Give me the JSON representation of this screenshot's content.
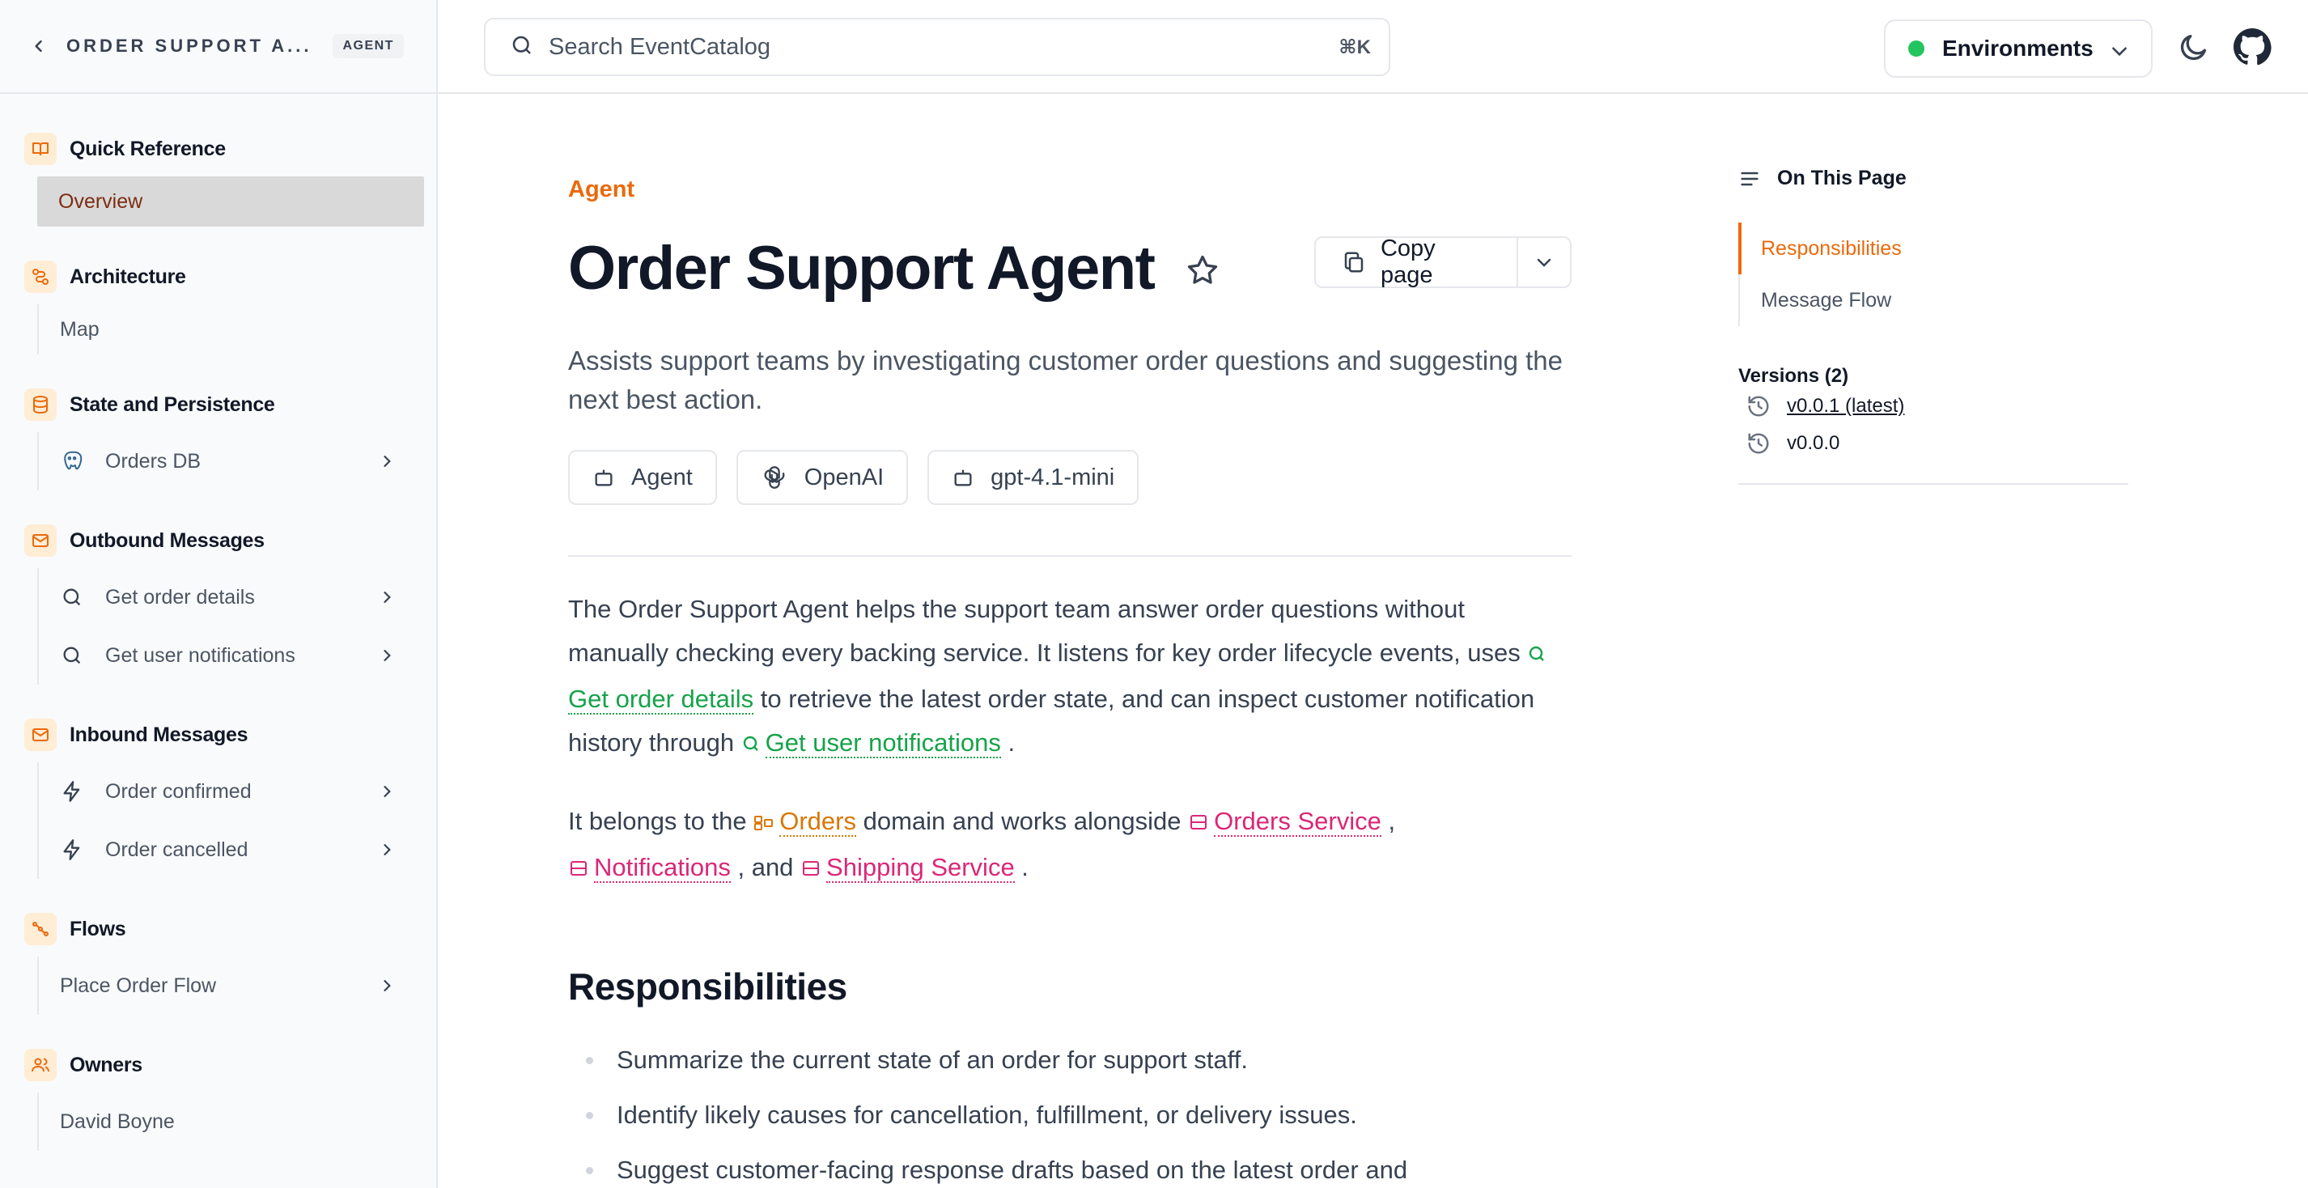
{
  "sidebar": {
    "title": "ORDER SUPPORT A...",
    "badge": "AGENT",
    "groups": [
      {
        "label": "Quick Reference",
        "icon": "book-icon",
        "items": [
          {
            "label": "Overview"
          }
        ]
      },
      {
        "label": "Architecture",
        "icon": "map-icon",
        "items": [
          {
            "label": "Map"
          }
        ]
      },
      {
        "label": "State and Persistence",
        "icon": "database-icon",
        "items": [
          {
            "label": "Orders DB"
          }
        ]
      },
      {
        "label": "Outbound Messages",
        "icon": "mail-icon",
        "items": [
          {
            "label": "Get order details"
          },
          {
            "label": "Get user notifications"
          }
        ]
      },
      {
        "label": "Inbound Messages",
        "icon": "mail-icon",
        "items": [
          {
            "label": "Order confirmed"
          },
          {
            "label": "Order cancelled"
          }
        ]
      },
      {
        "label": "Flows",
        "icon": "flow-icon",
        "items": [
          {
            "label": "Place Order Flow"
          }
        ]
      },
      {
        "label": "Owners",
        "icon": "users-icon",
        "items": [
          {
            "label": "David Boyne"
          }
        ]
      }
    ]
  },
  "topbar": {
    "search_placeholder": "Search EventCatalog",
    "shortcut": "⌘K",
    "environments": "Environments"
  },
  "main": {
    "kicker": "Agent",
    "title": "Order Support Agent",
    "copy_label": "Copy page",
    "summary": "Assists support teams by investigating customer order questions and suggesting the next best action.",
    "chips": [
      {
        "label": "Agent"
      },
      {
        "label": "OpenAI"
      },
      {
        "label": "gpt-4.1-mini"
      }
    ],
    "p1": {
      "t1": "The Order Support Agent helps the support team answer order questions without manually checking every backing service. It listens for key order lifecycle events, uses ",
      "link1": "Get order details",
      "t2": " to retrieve the latest order state, and can inspect customer notification history through ",
      "link2": "Get user notifications",
      "t3": " ."
    },
    "p2": {
      "t1": "It belongs to the ",
      "domain": "Orders",
      "t2": " domain and works alongside ",
      "svc1": "Orders Service",
      "t3": " ,",
      "svc2": "Notifications",
      "t4": " , and ",
      "svc3": "Shipping Service",
      "t5": " ."
    },
    "responsibilities_heading": "Responsibilities",
    "responsibilities": [
      "Summarize the current state of an order for support staff.",
      "Identify likely causes for cancellation, fulfillment, or delivery issues.",
      "Suggest customer-facing response drafts based on the latest order and"
    ]
  },
  "toc": {
    "heading": "On This Page",
    "items": [
      {
        "label": "Responsibilities"
      },
      {
        "label": "Message Flow"
      }
    ],
    "versions_heading": "Versions (2)",
    "versions": [
      {
        "label": "v0.0.1 (latest)"
      },
      {
        "label": "v0.0.0"
      }
    ]
  },
  "colors": {
    "accent": "#ea6a0c",
    "message_link": "#16a34a",
    "domain_link": "#d97706",
    "service_link": "#db2777",
    "env_status": "#22c55e"
  }
}
